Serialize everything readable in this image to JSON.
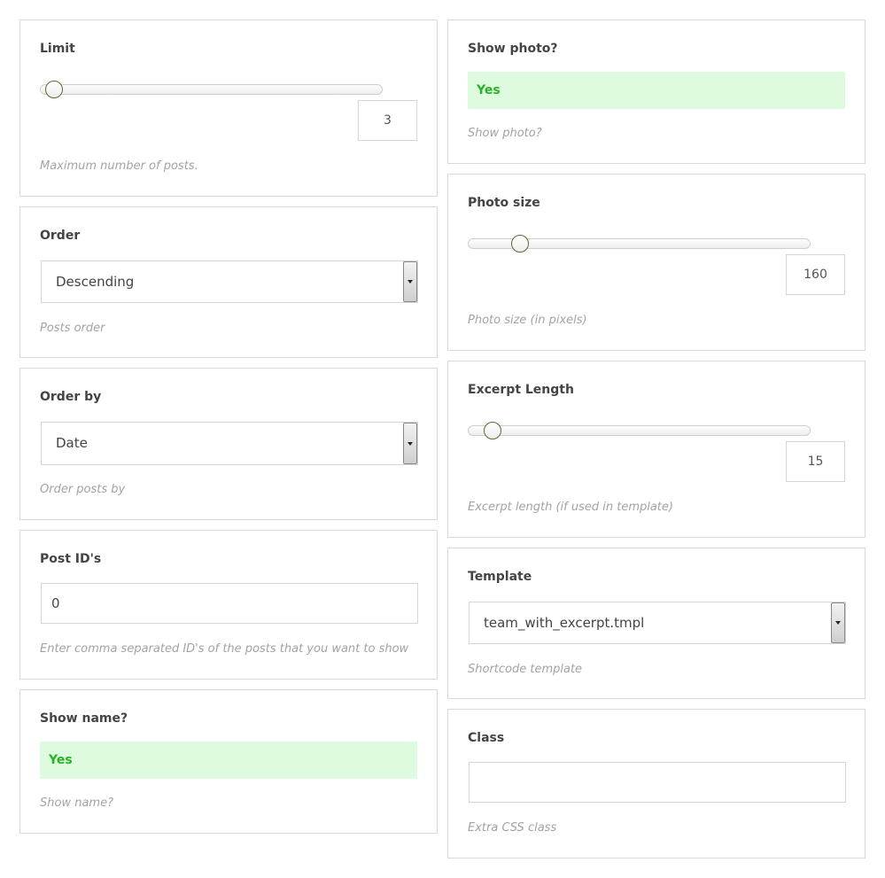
{
  "limit": {
    "label": "Limit",
    "value": "3",
    "slider_fraction": 0.04,
    "description": "Maximum number of posts."
  },
  "order": {
    "label": "Order",
    "selected": "Descending",
    "description": "Posts order"
  },
  "order_by": {
    "label": "Order by",
    "selected": "Date",
    "description": "Order posts by"
  },
  "post_ids": {
    "label": "Post ID's",
    "value": "0",
    "description": "Enter comma separated ID's of the posts that you want to show"
  },
  "show_name": {
    "label": "Show name?",
    "value": "Yes",
    "description": "Show name?"
  },
  "show_photo": {
    "label": "Show photo?",
    "value": "Yes",
    "description": "Show photo?"
  },
  "photo_size": {
    "label": "Photo size",
    "value": "160",
    "slider_fraction": 0.15,
    "description": "Photo size (in pixels)"
  },
  "excerpt_length": {
    "label": "Excerpt Length",
    "value": "15",
    "slider_fraction": 0.07,
    "description": "Excerpt length (if used in template)"
  },
  "template": {
    "label": "Template",
    "selected": "team_with_excerpt.tmpl",
    "description": "Shortcode template"
  },
  "class_field": {
    "label": "Class",
    "value": "",
    "description": "Extra CSS class"
  },
  "colors": {
    "toggle_bg": "#dffbdf",
    "toggle_text": "#28b228",
    "thumb_border": "#5a6a2c"
  }
}
